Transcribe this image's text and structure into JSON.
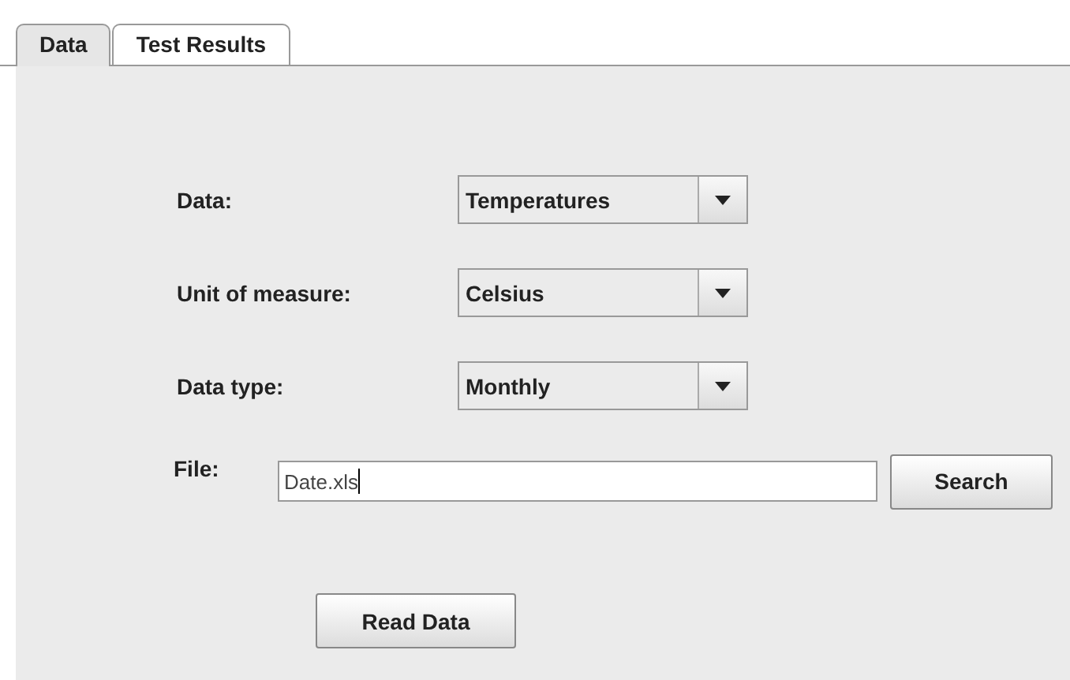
{
  "tabs": [
    {
      "label": "Data",
      "selected": true
    },
    {
      "label": "Test Results",
      "selected": false
    }
  ],
  "fields": [
    {
      "label": "Data:",
      "value": "Temperatures"
    },
    {
      "label": "Unit of measure:",
      "value": "Celsius"
    },
    {
      "label": "Data type:",
      "value": "Monthly"
    }
  ],
  "file": {
    "label": "File:",
    "value": "Date.xls",
    "button": "Search"
  },
  "read_button": "Read Data"
}
